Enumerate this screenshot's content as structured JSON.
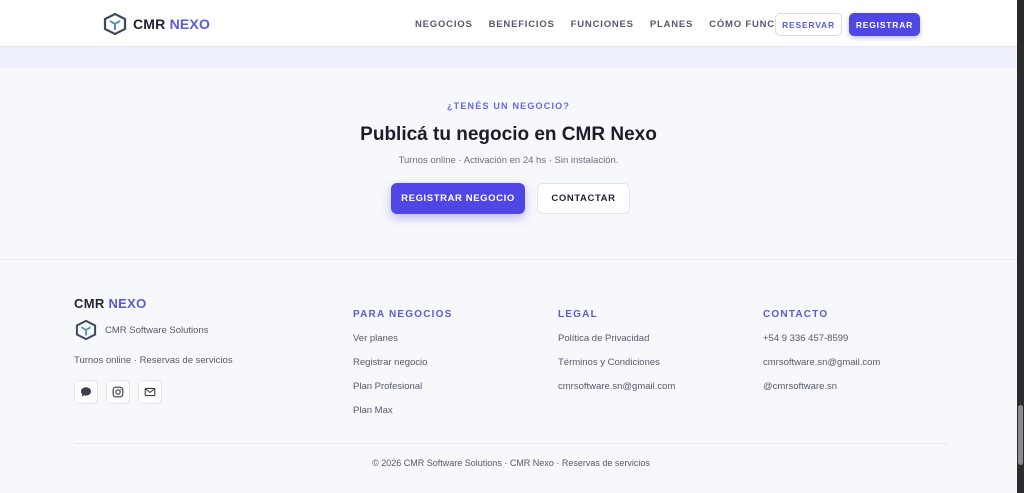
{
  "header": {
    "brand": {
      "name": "CMR",
      "accent": "NEXO"
    },
    "nav": [
      "NEGOCIOS",
      "BENEFICIOS",
      "FUNCIONES",
      "PLANES",
      "CÓMO FUNCIONA"
    ],
    "reservar_label": "RESERVAR",
    "registrar_label": "REGISTRAR"
  },
  "cta": {
    "eyebrow": "¿TENÉS UN NEGOCIO?",
    "title": "Publicá tu negocio en CMR Nexo",
    "subtitle": "Turnos online · Activación en 24 hs · Sin instalación.",
    "primary_label": "REGISTRAR NEGOCIO",
    "secondary_label": "CONTACTAR"
  },
  "footer": {
    "brand": {
      "name": "CMR",
      "accent": "NEXO"
    },
    "company": "CMR Software Solutions",
    "tagline": "Turnos online · Reservas de servicios",
    "socials": [
      "chat-icon",
      "instagram-icon",
      "mail-icon"
    ],
    "columns": [
      {
        "title": "PARA NEGOCIOS",
        "items": [
          "Ver planes",
          "Registrar negocio",
          "Plan Profesional",
          "Plan Max"
        ]
      },
      {
        "title": "LEGAL",
        "items": [
          "Política de Privacidad",
          "Términos y Condiciones",
          "cmrsoftware.sn@gmail.com"
        ]
      },
      {
        "title": "CONTACTO",
        "items": [
          "+54 9 336 457-8599",
          "cmrsoftware.sn@gmail.com",
          "@cmrsoftware.sn"
        ]
      }
    ],
    "copyright": "© 2026 CMR Software Solutions · CMR Nexo · Reservas de servicios"
  },
  "colors": {
    "accent": "#4f46e5",
    "accent_text": "#5b5bd6",
    "background": "#f7f8fb"
  }
}
